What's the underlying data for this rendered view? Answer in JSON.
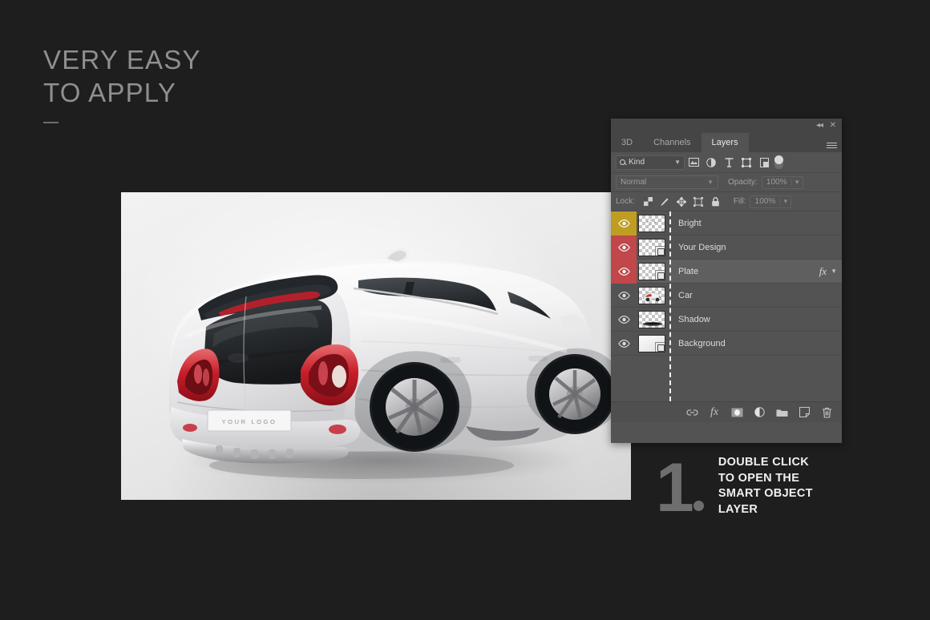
{
  "headline": {
    "line1": "VERY EASY",
    "line2": "TO APPLY"
  },
  "mockup": {
    "plate_text": "YOUR LOGO",
    "alt": "white crossover car rear three-quarter view"
  },
  "panel": {
    "titlebar": {
      "collapse_icon": "double-chevron-left-icon",
      "close_icon": "close-icon"
    },
    "tabs": [
      {
        "label": "3D",
        "active": false
      },
      {
        "label": "Channels",
        "active": false
      },
      {
        "label": "Layers",
        "active": true
      }
    ],
    "menu_icon": "panel-menu-icon",
    "filter": {
      "kind_label": "Kind",
      "search_icon": "search-icon",
      "caret_icon": "chevron-down-icon",
      "icons": [
        "pixel-layer-filter-icon",
        "adjustment-layer-filter-icon",
        "type-layer-filter-icon",
        "shape-layer-filter-icon",
        "smart-object-filter-icon"
      ],
      "toggle_name": "filter-enable-toggle"
    },
    "blend": {
      "mode": "Normal",
      "opacity_label": "Opacity:",
      "opacity_value": "100%"
    },
    "lock": {
      "label": "Lock:",
      "icons": [
        "lock-transparent-pixels-icon",
        "lock-image-pixels-icon",
        "lock-position-icon",
        "lock-artboard-nesting-icon",
        "lock-all-icon"
      ],
      "fill_label": "Fill:",
      "fill_value": "100%"
    },
    "layers": [
      {
        "name": "Bright",
        "color": "#bf9d22",
        "selected": false,
        "smart_object": false,
        "fx": false,
        "visible": true
      },
      {
        "name": "Your Design",
        "color": "#c0474a",
        "selected": false,
        "smart_object": true,
        "fx": false,
        "visible": true
      },
      {
        "name": "Plate",
        "color": "#c0474a",
        "selected": true,
        "smart_object": true,
        "fx": true,
        "visible": true
      },
      {
        "name": "Car",
        "color": "",
        "selected": false,
        "smart_object": false,
        "fx": false,
        "visible": true
      },
      {
        "name": "Shadow",
        "color": "",
        "selected": false,
        "smart_object": false,
        "fx": false,
        "visible": true
      },
      {
        "name": "Background",
        "color": "",
        "selected": false,
        "smart_object": true,
        "fx": false,
        "visible": true
      }
    ],
    "fx_label": "fx",
    "bottom_icons": [
      "link-layers-icon",
      "add-layer-style-icon",
      "add-layer-mask-icon",
      "new-adjustment-layer-icon",
      "new-group-icon",
      "new-layer-icon",
      "delete-layer-icon"
    ]
  },
  "callout": {
    "number": "1",
    "lines": [
      "DOUBLE CLICK",
      "TO OPEN THE",
      "SMART OBJECT",
      "LAYER"
    ]
  },
  "colors": {
    "background": "#1e1e1e",
    "panel": "#535353",
    "panel_header": "#454545",
    "label_gold": "#bf9d22",
    "label_red": "#c0474a",
    "text": "#dcdcdc",
    "heading": "#8f8f8f"
  }
}
